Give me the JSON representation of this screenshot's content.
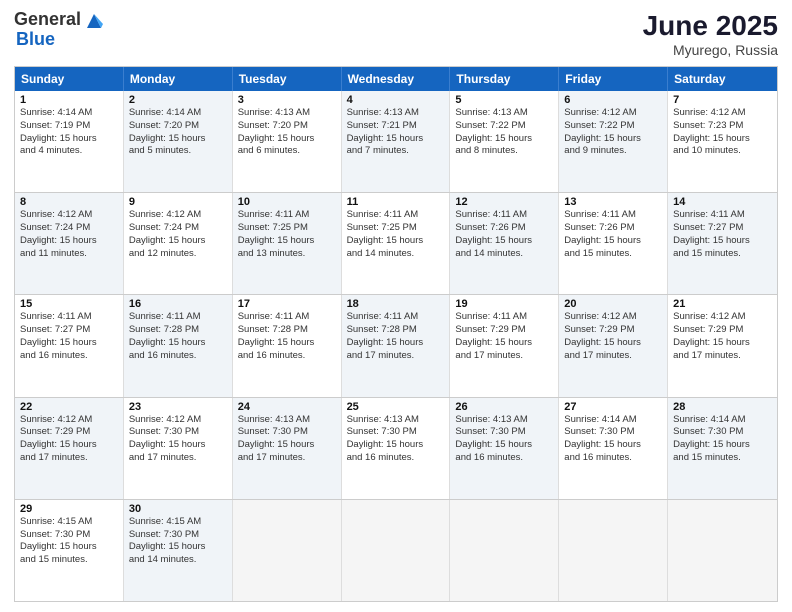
{
  "header": {
    "logo_general": "General",
    "logo_blue": "Blue",
    "title": "June 2025",
    "location": "Myurego, Russia"
  },
  "days_of_week": [
    "Sunday",
    "Monday",
    "Tuesday",
    "Wednesday",
    "Thursday",
    "Friday",
    "Saturday"
  ],
  "weeks": [
    [
      {
        "day": "1",
        "info": "Sunrise: 4:14 AM\nSunset: 7:19 PM\nDaylight: 15 hours\nand 4 minutes.",
        "shaded": false
      },
      {
        "day": "2",
        "info": "Sunrise: 4:14 AM\nSunset: 7:20 PM\nDaylight: 15 hours\nand 5 minutes.",
        "shaded": true
      },
      {
        "day": "3",
        "info": "Sunrise: 4:13 AM\nSunset: 7:20 PM\nDaylight: 15 hours\nand 6 minutes.",
        "shaded": false
      },
      {
        "day": "4",
        "info": "Sunrise: 4:13 AM\nSunset: 7:21 PM\nDaylight: 15 hours\nand 7 minutes.",
        "shaded": true
      },
      {
        "day": "5",
        "info": "Sunrise: 4:13 AM\nSunset: 7:22 PM\nDaylight: 15 hours\nand 8 minutes.",
        "shaded": false
      },
      {
        "day": "6",
        "info": "Sunrise: 4:12 AM\nSunset: 7:22 PM\nDaylight: 15 hours\nand 9 minutes.",
        "shaded": true
      },
      {
        "day": "7",
        "info": "Sunrise: 4:12 AM\nSunset: 7:23 PM\nDaylight: 15 hours\nand 10 minutes.",
        "shaded": false
      }
    ],
    [
      {
        "day": "8",
        "info": "Sunrise: 4:12 AM\nSunset: 7:24 PM\nDaylight: 15 hours\nand 11 minutes.",
        "shaded": true
      },
      {
        "day": "9",
        "info": "Sunrise: 4:12 AM\nSunset: 7:24 PM\nDaylight: 15 hours\nand 12 minutes.",
        "shaded": false
      },
      {
        "day": "10",
        "info": "Sunrise: 4:11 AM\nSunset: 7:25 PM\nDaylight: 15 hours\nand 13 minutes.",
        "shaded": true
      },
      {
        "day": "11",
        "info": "Sunrise: 4:11 AM\nSunset: 7:25 PM\nDaylight: 15 hours\nand 14 minutes.",
        "shaded": false
      },
      {
        "day": "12",
        "info": "Sunrise: 4:11 AM\nSunset: 7:26 PM\nDaylight: 15 hours\nand 14 minutes.",
        "shaded": true
      },
      {
        "day": "13",
        "info": "Sunrise: 4:11 AM\nSunset: 7:26 PM\nDaylight: 15 hours\nand 15 minutes.",
        "shaded": false
      },
      {
        "day": "14",
        "info": "Sunrise: 4:11 AM\nSunset: 7:27 PM\nDaylight: 15 hours\nand 15 minutes.",
        "shaded": true
      }
    ],
    [
      {
        "day": "15",
        "info": "Sunrise: 4:11 AM\nSunset: 7:27 PM\nDaylight: 15 hours\nand 16 minutes.",
        "shaded": false
      },
      {
        "day": "16",
        "info": "Sunrise: 4:11 AM\nSunset: 7:28 PM\nDaylight: 15 hours\nand 16 minutes.",
        "shaded": true
      },
      {
        "day": "17",
        "info": "Sunrise: 4:11 AM\nSunset: 7:28 PM\nDaylight: 15 hours\nand 16 minutes.",
        "shaded": false
      },
      {
        "day": "18",
        "info": "Sunrise: 4:11 AM\nSunset: 7:28 PM\nDaylight: 15 hours\nand 17 minutes.",
        "shaded": true
      },
      {
        "day": "19",
        "info": "Sunrise: 4:11 AM\nSunset: 7:29 PM\nDaylight: 15 hours\nand 17 minutes.",
        "shaded": false
      },
      {
        "day": "20",
        "info": "Sunrise: 4:12 AM\nSunset: 7:29 PM\nDaylight: 15 hours\nand 17 minutes.",
        "shaded": true
      },
      {
        "day": "21",
        "info": "Sunrise: 4:12 AM\nSunset: 7:29 PM\nDaylight: 15 hours\nand 17 minutes.",
        "shaded": false
      }
    ],
    [
      {
        "day": "22",
        "info": "Sunrise: 4:12 AM\nSunset: 7:29 PM\nDaylight: 15 hours\nand 17 minutes.",
        "shaded": true
      },
      {
        "day": "23",
        "info": "Sunrise: 4:12 AM\nSunset: 7:30 PM\nDaylight: 15 hours\nand 17 minutes.",
        "shaded": false
      },
      {
        "day": "24",
        "info": "Sunrise: 4:13 AM\nSunset: 7:30 PM\nDaylight: 15 hours\nand 17 minutes.",
        "shaded": true
      },
      {
        "day": "25",
        "info": "Sunrise: 4:13 AM\nSunset: 7:30 PM\nDaylight: 15 hours\nand 16 minutes.",
        "shaded": false
      },
      {
        "day": "26",
        "info": "Sunrise: 4:13 AM\nSunset: 7:30 PM\nDaylight: 15 hours\nand 16 minutes.",
        "shaded": true
      },
      {
        "day": "27",
        "info": "Sunrise: 4:14 AM\nSunset: 7:30 PM\nDaylight: 15 hours\nand 16 minutes.",
        "shaded": false
      },
      {
        "day": "28",
        "info": "Sunrise: 4:14 AM\nSunset: 7:30 PM\nDaylight: 15 hours\nand 15 minutes.",
        "shaded": true
      }
    ],
    [
      {
        "day": "29",
        "info": "Sunrise: 4:15 AM\nSunset: 7:30 PM\nDaylight: 15 hours\nand 15 minutes.",
        "shaded": false
      },
      {
        "day": "30",
        "info": "Sunrise: 4:15 AM\nSunset: 7:30 PM\nDaylight: 15 hours\nand 14 minutes.",
        "shaded": true
      },
      {
        "day": "",
        "info": "",
        "shaded": true,
        "empty": true
      },
      {
        "day": "",
        "info": "",
        "shaded": true,
        "empty": true
      },
      {
        "day": "",
        "info": "",
        "shaded": true,
        "empty": true
      },
      {
        "day": "",
        "info": "",
        "shaded": true,
        "empty": true
      },
      {
        "day": "",
        "info": "",
        "shaded": true,
        "empty": true
      }
    ]
  ]
}
